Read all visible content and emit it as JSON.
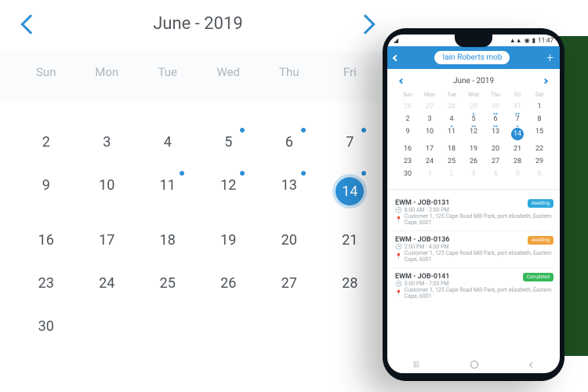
{
  "desktop_calendar": {
    "title": "June - 2019",
    "dow": [
      "Sun",
      "Mon",
      "Tue",
      "Wed",
      "Thu",
      "Fri"
    ],
    "weeks": [
      [
        {
          "n": "2"
        },
        {
          "n": "3"
        },
        {
          "n": "4"
        },
        {
          "n": "5",
          "dot": true
        },
        {
          "n": "6",
          "dot": true
        },
        {
          "n": "7",
          "dot": true
        }
      ],
      [
        {
          "n": "9"
        },
        {
          "n": "10"
        },
        {
          "n": "11",
          "dot": true
        },
        {
          "n": "12",
          "dot": true
        },
        {
          "n": "13",
          "dot": true
        },
        {
          "n": "14",
          "dot": true,
          "selected": true
        }
      ],
      [
        {
          "n": "16"
        },
        {
          "n": "17"
        },
        {
          "n": "18"
        },
        {
          "n": "19"
        },
        {
          "n": "20"
        },
        {
          "n": "21"
        }
      ],
      [
        {
          "n": "23"
        },
        {
          "n": "24"
        },
        {
          "n": "25"
        },
        {
          "n": "26"
        },
        {
          "n": "27"
        },
        {
          "n": "28"
        }
      ],
      [
        {
          "n": "30"
        }
      ]
    ]
  },
  "phone": {
    "status_time": "11:47",
    "user_pill": "Iain Roberts mob",
    "calendar": {
      "title": "June - 2019",
      "dow": [
        "Sun",
        "Mon",
        "Tue",
        "Wed",
        "Thu",
        "Fri",
        "Sat"
      ],
      "weeks": [
        [
          {
            "n": "26",
            "o": true
          },
          {
            "n": "27",
            "o": true
          },
          {
            "n": "28",
            "o": true
          },
          {
            "n": "29",
            "o": true
          },
          {
            "n": "30",
            "o": true
          },
          {
            "n": "31",
            "o": true
          },
          {
            "n": "1"
          }
        ],
        [
          {
            "n": "2"
          },
          {
            "n": "3"
          },
          {
            "n": "4"
          },
          {
            "n": "5",
            "d": 1
          },
          {
            "n": "6",
            "d": 2
          },
          {
            "n": "7",
            "d": 2
          },
          {
            "n": "8"
          }
        ],
        [
          {
            "n": "9"
          },
          {
            "n": "10"
          },
          {
            "n": "11",
            "d": 1
          },
          {
            "n": "12",
            "d": 2
          },
          {
            "n": "13",
            "d": 2
          },
          {
            "n": "14",
            "sel": true,
            "d": 1
          },
          {
            "n": "15"
          }
        ],
        [
          {
            "n": "16"
          },
          {
            "n": "17"
          },
          {
            "n": "18"
          },
          {
            "n": "19"
          },
          {
            "n": "20"
          },
          {
            "n": "21"
          },
          {
            "n": "22"
          }
        ],
        [
          {
            "n": "23"
          },
          {
            "n": "24"
          },
          {
            "n": "25"
          },
          {
            "n": "26"
          },
          {
            "n": "27"
          },
          {
            "n": "28"
          },
          {
            "n": "29"
          }
        ],
        [
          {
            "n": "30"
          },
          {
            "n": "1",
            "o": true
          },
          {
            "n": "2",
            "o": true
          },
          {
            "n": "3",
            "o": true
          },
          {
            "n": "4",
            "o": true
          },
          {
            "n": "5",
            "o": true
          },
          {
            "n": "6",
            "o": true
          }
        ]
      ]
    },
    "jobs": [
      {
        "id": "EWM - JOB-0131",
        "time": "8:00 AM - 2:00 PM",
        "addr": "Customer 1, 125 Cape Road Mill Park, port elizabeth, Eastern Cape, 6001",
        "badge": "Awaiting",
        "badge_type": "await"
      },
      {
        "id": "EWM - JOB-0136",
        "time": "2:00 PM - 4:00 PM",
        "addr": "Customer 1, 125 Cape Road Mill Park, port elizabeth, Eastern Cape, 6001",
        "badge": "Awaiting",
        "badge_type": "amb"
      },
      {
        "id": "EWM - JOB-0141",
        "time": "5:00 PM - 7:00 PM",
        "addr": "Customer 1, 125 Cape Road Mill Park, port elizabeth, Eastern Cape, 6001",
        "badge": "Completed",
        "badge_type": "comp"
      }
    ]
  }
}
